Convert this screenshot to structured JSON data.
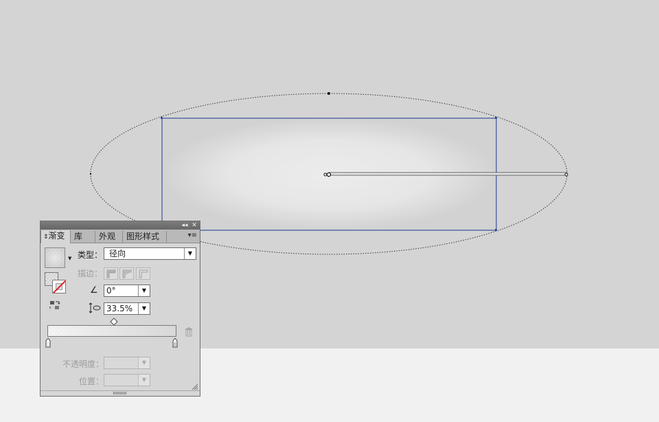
{
  "panel": {
    "tabs": [
      "渐变",
      "库",
      "外观",
      "图形样式"
    ],
    "active_tab": "渐变",
    "collapse_glyph": "◂◂",
    "close_glyph": "✕",
    "menu_glyph": "▾≡",
    "type_label": "类型：",
    "type_value": "径向",
    "stroke_label": "描边：",
    "angle_value": "0°",
    "aspect_value": "33.5%",
    "opacity_label": "不透明度：",
    "opacity_value": "",
    "location_label": "位置：",
    "location_value": ""
  },
  "icons": {
    "tab_arrows": "⇕",
    "dropdown": "▼",
    "angle": "∠"
  },
  "colors": {
    "canvas_bg": "#d4d4d4",
    "bottom_bg": "#f2f1f2",
    "selection_blue": "#3a4f9a",
    "panel_bg": "#d6d6d6"
  }
}
